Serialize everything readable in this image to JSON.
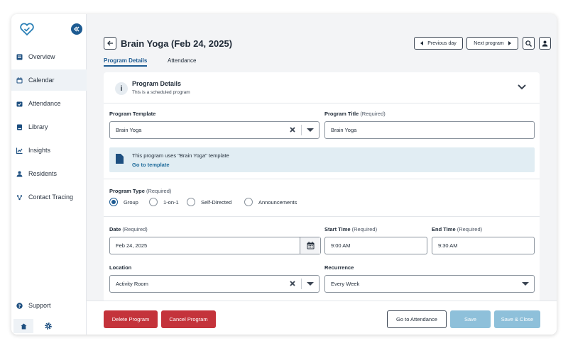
{
  "header": {
    "title": "Brain Yoga (Feb 24, 2025)",
    "prev_day": "Previous day",
    "next_program": "Next program"
  },
  "tabs": [
    {
      "label": "Program Details",
      "active": true
    },
    {
      "label": "Attendance",
      "active": false
    }
  ],
  "sidebar": {
    "items": [
      {
        "label": "Overview",
        "icon": "overview-icon"
      },
      {
        "label": "Calendar",
        "icon": "calendar-icon",
        "active": true
      },
      {
        "label": "Attendance",
        "icon": "attendance-icon"
      },
      {
        "label": "Library",
        "icon": "library-icon"
      },
      {
        "label": "Insights",
        "icon": "insights-icon"
      },
      {
        "label": "Residents",
        "icon": "residents-icon"
      },
      {
        "label": "Contact Tracing",
        "icon": "contact-tracing-icon"
      }
    ],
    "support": "Support"
  },
  "card": {
    "title": "Program Details",
    "subtitle": "This is a scheduled program"
  },
  "form": {
    "template": {
      "label": "Program Template",
      "value": "Brain Yoga"
    },
    "title": {
      "label": "Program Title",
      "required": "(Required)",
      "value": "Brain Yoga"
    },
    "banner": {
      "text": "This program uses \"Brain Yoga\" template",
      "link": "Go to template"
    },
    "type": {
      "label": "Program Type",
      "required": "(Required)",
      "options": [
        "Group",
        "1-on-1",
        "Self-Directed",
        "Announcements"
      ],
      "selected": "Group"
    },
    "date": {
      "label": "Date",
      "required": "(Required)",
      "value": "Feb 24, 2025"
    },
    "start_time": {
      "label": "Start Time",
      "required": "(Required)",
      "value": "9:00 AM"
    },
    "end_time": {
      "label": "End Time",
      "required": "(Required)",
      "value": "9:30 AM"
    },
    "location": {
      "label": "Location",
      "value": "Activity Room"
    },
    "recurrence": {
      "label": "Recurrence",
      "value": "Every Week"
    }
  },
  "footer": {
    "delete": "Delete Program",
    "cancel": "Cancel Program",
    "go_attendance": "Go to Attendance",
    "save": "Save",
    "save_close": "Save & Close"
  },
  "colors": {
    "brand": "#1d5b92",
    "danger": "#c4333b",
    "save_disabled": "#8ec0da",
    "banner_bg": "#e1edf3"
  }
}
